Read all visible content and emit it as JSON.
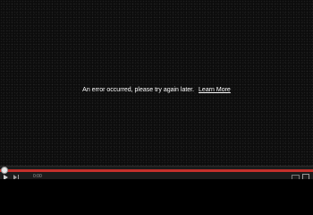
{
  "error": {
    "message": "An error occurred, please try again later.",
    "link_label": "Learn More"
  },
  "controls": {
    "time": "0:00",
    "progress_percent": 0,
    "play_icon": "play-icon",
    "next_icon": "next-icon",
    "fullscreen_icon": "fullscreen-icon",
    "size_icon": "player-size-icon"
  },
  "colors": {
    "background": "#0c0c0c",
    "progress_bar": "#c4302b",
    "text": "#ffffff"
  }
}
